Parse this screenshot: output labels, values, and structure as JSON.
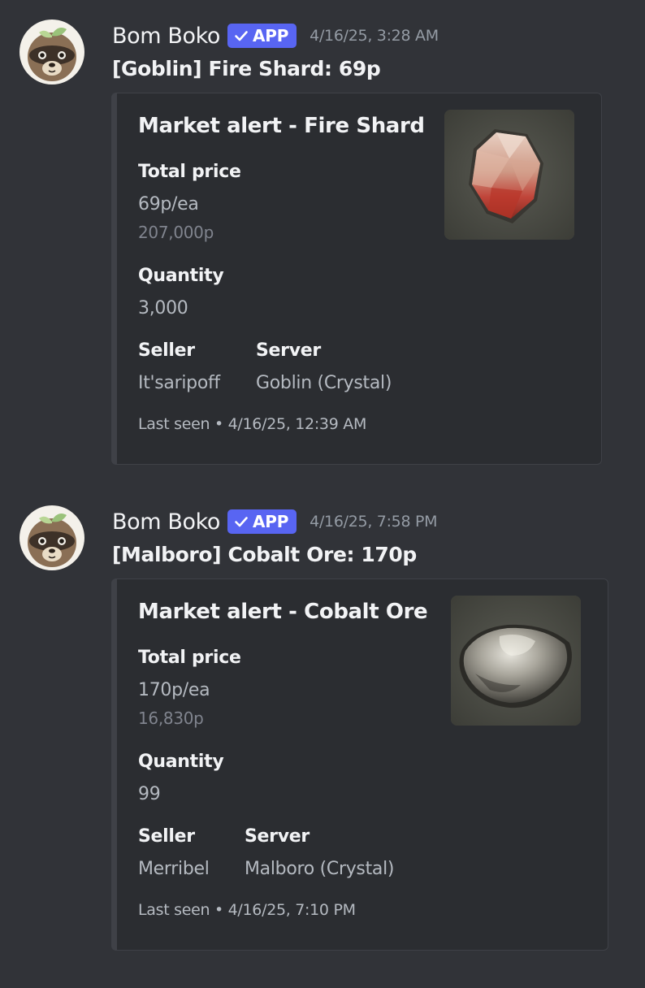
{
  "messages": [
    {
      "author": "Bom Boko",
      "badge": "APP",
      "timestamp": "4/16/25, 3:28 AM",
      "content": "[Goblin] Fire Shard: 69p",
      "embed": {
        "title": "Market alert - Fire Shard",
        "total_price_label": "Total price",
        "price_each": "69p/ea",
        "price_total": "207,000p",
        "quantity_label": "Quantity",
        "quantity": "3,000",
        "seller_label": "Seller",
        "seller": "It'saripoff",
        "server_label": "Server",
        "server": "Goblin (Crystal)",
        "footer": "Last seen • 4/16/25, 12:39 AM",
        "thumbnail_icon": "fire-shard-icon"
      }
    },
    {
      "author": "Bom Boko",
      "badge": "APP",
      "timestamp": "4/16/25, 7:58 PM",
      "content": "[Malboro] Cobalt Ore: 170p",
      "embed": {
        "title": "Market alert - Cobalt Ore",
        "total_price_label": "Total price",
        "price_each": "170p/ea",
        "price_total": "16,830p",
        "quantity_label": "Quantity",
        "quantity": "99",
        "seller_label": "Seller",
        "seller": "Merribel",
        "server_label": "Server",
        "server": "Malboro (Crystal)",
        "footer": "Last seen • 4/16/25, 7:10 PM",
        "thumbnail_icon": "cobalt-ore-icon"
      }
    }
  ],
  "colors": {
    "background": "#313338",
    "embed_background": "#2b2d31",
    "badge": "#5865f2"
  }
}
